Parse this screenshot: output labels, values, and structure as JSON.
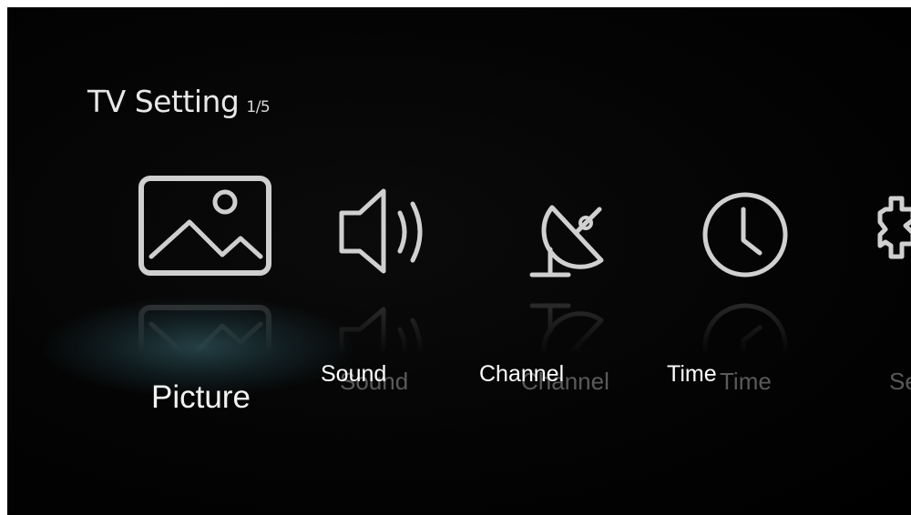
{
  "header": {
    "title": "TV Setting",
    "page_counter": "1/5"
  },
  "menu": {
    "selected": "Picture",
    "items": [
      {
        "id": "picture",
        "label": "Picture",
        "icon": "picture-icon"
      },
      {
        "id": "sound",
        "label": "Sound",
        "icon": "speaker-icon"
      },
      {
        "id": "channel",
        "label": "Channel",
        "icon": "satellite-dish-icon"
      },
      {
        "id": "time",
        "label": "Time",
        "icon": "clock-icon"
      },
      {
        "id": "setup",
        "label": "Se",
        "icon": "gear-icon"
      }
    ]
  },
  "colors": {
    "background": "#000000",
    "icon_stroke": "#d6d6d6",
    "selected_glow": "#3c6e78",
    "text": "#ffffff"
  }
}
